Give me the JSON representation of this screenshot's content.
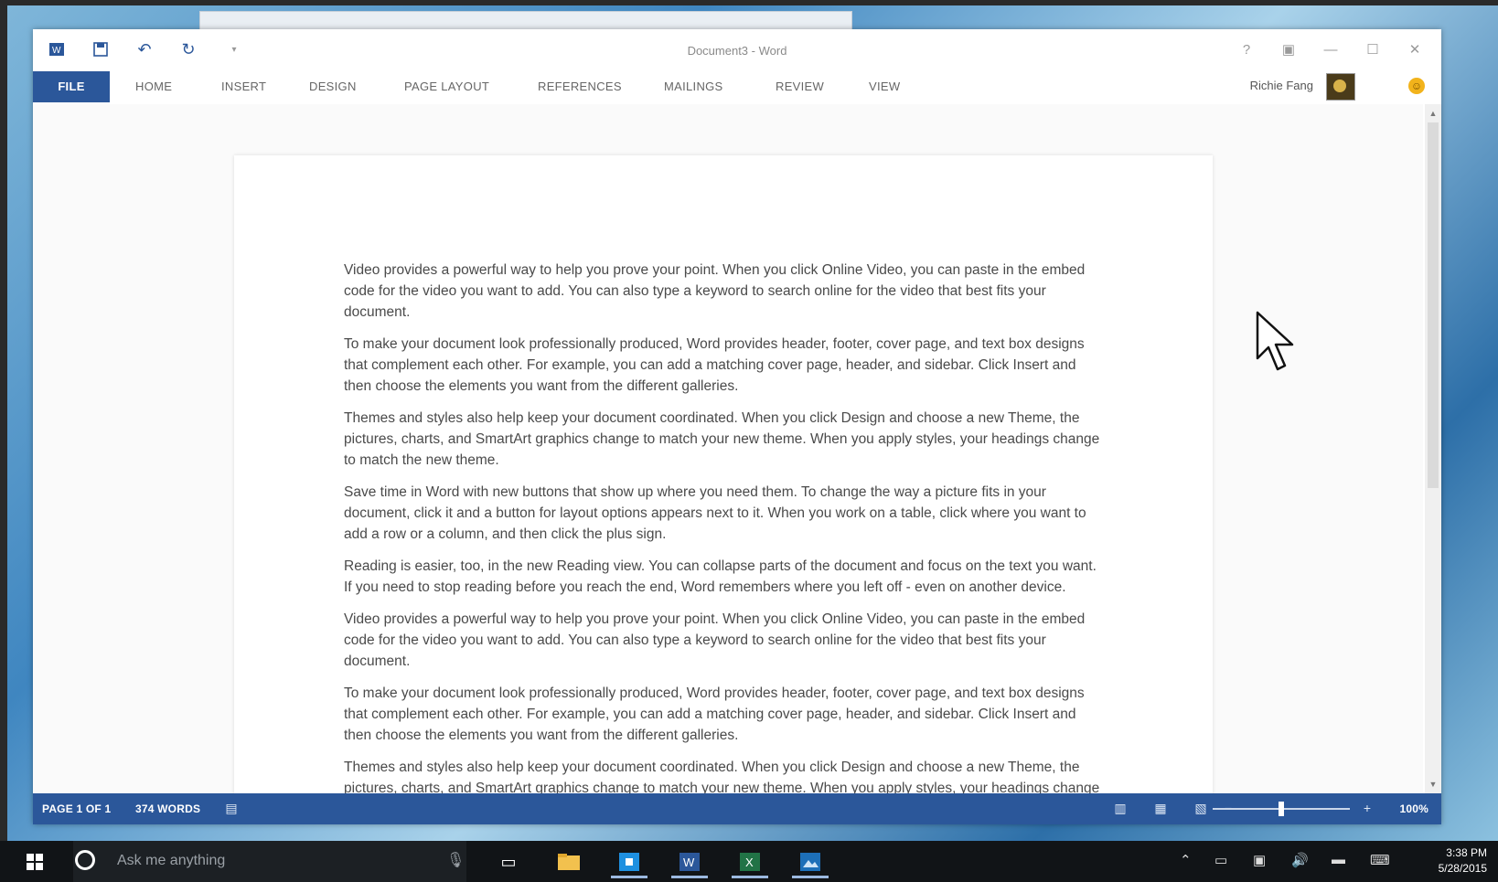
{
  "window": {
    "title": "Document3 - Word",
    "qat": {
      "undo_icon": "undo-icon",
      "redo_icon": "redo-icon",
      "save_icon": "save-icon"
    }
  },
  "ribbon": {
    "tabs": [
      "FILE",
      "HOME",
      "INSERT",
      "DESIGN",
      "PAGE LAYOUT",
      "REFERENCES",
      "MAILINGS",
      "REVIEW",
      "VIEW"
    ],
    "user_name": "Richie Fang"
  },
  "document": {
    "paragraphs": [
      "Video provides a powerful way to help you prove your point. When you click Online Video, you can paste in the embed code for the video you want to add. You can also type a keyword to search online for the video that best fits your document.",
      "To make your document look professionally produced, Word provides header, footer, cover page, and text box designs that complement each other. For example, you can add a matching cover page, header, and sidebar. Click Insert and then choose the elements you want from the different galleries.",
      "Themes and styles also help keep your document coordinated. When you click Design and choose a new Theme, the pictures, charts, and SmartArt graphics change to match your new theme. When you apply styles, your headings change to match the new theme.",
      "Save time in Word with new buttons that show up where you need them. To change the way a picture fits in your document, click it and a button for layout options appears next to it. When you work on a table, click where you want to add a row or a column, and then click the plus sign.",
      "Reading is easier, too, in the new Reading view. You can collapse parts of the document and focus on the text you want. If you need to stop reading before you reach the end, Word remembers where you left off - even on another device.",
      "Video provides a powerful way to help you prove your point. When you click Online Video, you can paste in the embed code for the video you want to add. You can also type a keyword to search online for the video that best fits your document.",
      "To make your document look professionally produced, Word provides header, footer, cover page, and text box designs that complement each other. For example, you can add a matching cover page, header, and sidebar. Click Insert and then choose the elements you want from the different galleries.",
      "Themes and styles also help keep your document coordinated. When you click Design and choose a new Theme, the pictures, charts, and SmartArt graphics change to match your new theme. When you apply styles, your headings change to match the new theme."
    ]
  },
  "status": {
    "page": "PAGE 1 OF 1",
    "words": "374 WORDS",
    "zoom": "100%",
    "zoom_level": 0.5
  },
  "taskbar": {
    "search_placeholder": "Ask me anything",
    "time": "3:38 PM",
    "date": "5/28/2015"
  },
  "colors": {
    "accent": "#2b579a",
    "taskbar": "#111417"
  }
}
